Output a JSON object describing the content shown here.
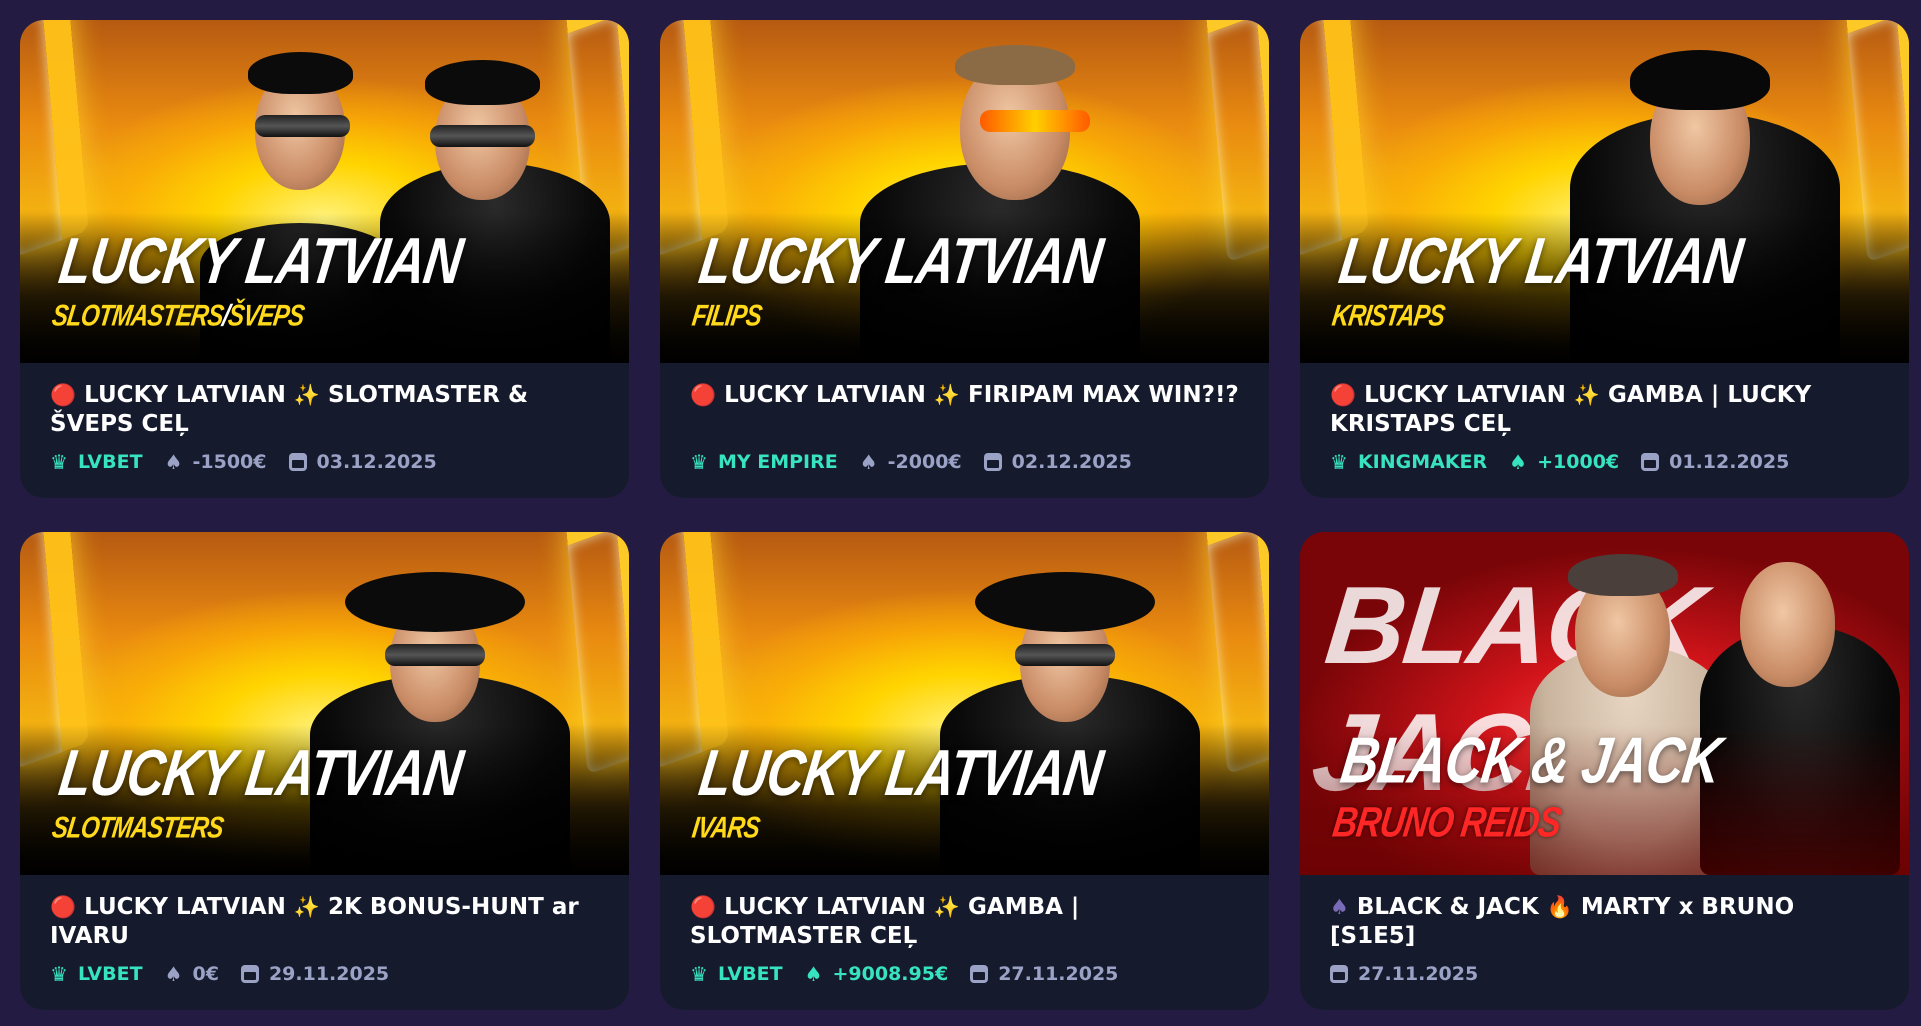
{
  "cards": [
    {
      "thumb_title": "LUCKY LATVIAN",
      "thumb_sub_a": "SLOTMASTERS",
      "thumb_sub_sep": "/",
      "thumb_sub_b": "ŠVEPS",
      "status_emoji": "🔴",
      "title_pre": "LUCKY LATVIAN",
      "sparkle": "✨",
      "title_post": "SLOTMASTER & ŠVEPS CEĻ",
      "brand_icon": "♛",
      "brand": "LVBET",
      "result_icon": "♠",
      "result": "-1500€",
      "date": "03.12.2025"
    },
    {
      "thumb_title": "LUCKY LATVIAN",
      "thumb_sub_a": "FILIPS",
      "status_emoji": "🔴",
      "title_pre": "LUCKY LATVIAN",
      "sparkle": "✨",
      "title_post": "FIRIPAM MAX WIN?!?",
      "brand_icon": "♛",
      "brand": "MY EMPIRE",
      "result_icon": "♠",
      "result": "-2000€",
      "date": "02.12.2025"
    },
    {
      "thumb_title": "LUCKY LATVIAN",
      "thumb_sub_a": "KRISTAPS",
      "status_emoji": "🔴",
      "title_pre": "LUCKY LATVIAN",
      "sparkle": "✨",
      "title_post": "GAMBA | LUCKY KRISTAPS CEĻ",
      "brand_icon": "♛",
      "brand": "KINGMAKER",
      "result_icon": "♠",
      "result": "+1000€",
      "date": "01.12.2025"
    },
    {
      "thumb_title": "LUCKY LATVIAN",
      "thumb_sub_a": "SLOTMASTERS",
      "status_emoji": "🔴",
      "title_pre": "LUCKY LATVIAN",
      "sparkle": "✨",
      "title_post": "2K BONUS-HUNT ar IVARU",
      "brand_icon": "♛",
      "brand": "LVBET",
      "result_icon": "♠",
      "result": "0€",
      "date": "29.11.2025"
    },
    {
      "thumb_title": "LUCKY LATVIAN",
      "thumb_sub_a": "IVARS",
      "status_emoji": "🔴",
      "title_pre": "LUCKY LATVIAN",
      "sparkle": "✨",
      "title_post": "GAMBA | SLOTMASTER CEĻ",
      "brand_icon": "♛",
      "brand": "LVBET",
      "result_icon": "♠",
      "result": "+9008.95€",
      "date": "27.11.2025"
    },
    {
      "thumb_bg_word": "BLACK JACK",
      "thumb_title": "BLACK & JACK",
      "thumb_sub_a": "BRUNO REIDS",
      "status_emoji": "♠",
      "title_pre": "BLACK & JACK",
      "fire": "🔥",
      "title_post": "MARTY x BRUNO [S1E5]",
      "date": "27.11.2025"
    }
  ],
  "colors": {
    "page_bg": "#241b42",
    "card_bg": "#161a2d",
    "accent_teal": "#37e3c0",
    "muted": "#9aa2c5",
    "thumb_yellow": "#ffd91a",
    "thumb_red": "#ff2626"
  }
}
